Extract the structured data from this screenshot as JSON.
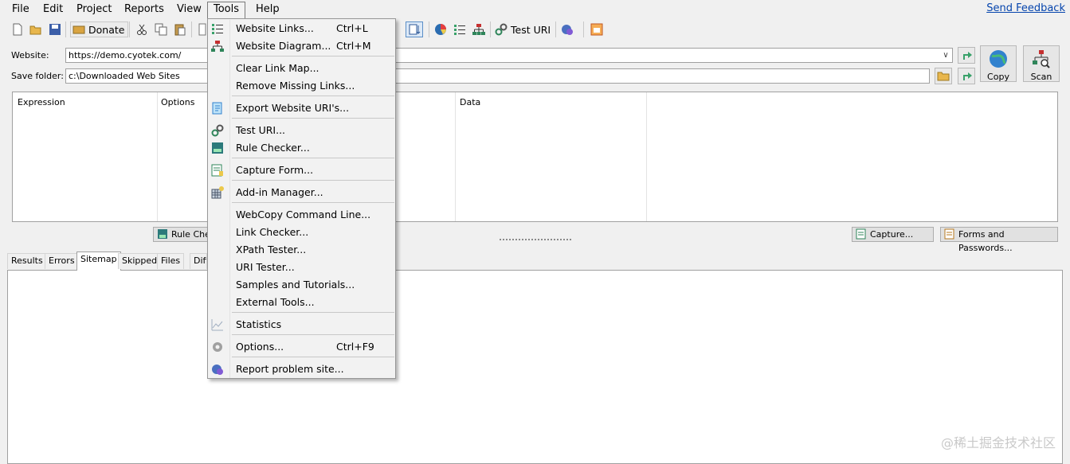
{
  "menubar": {
    "items": [
      "File",
      "Edit",
      "Project",
      "Reports",
      "View",
      "Tools",
      "Help"
    ],
    "feedback": "Send Feedback"
  },
  "toolbar": {
    "donate_label": "Donate",
    "test_uri_label": "Test URI"
  },
  "form": {
    "website_label": "Website:",
    "website_value": "https://demo.cyotek.com/",
    "save_folder_label": "Save folder:",
    "save_folder_value": "c:\\Downloaded Web Sites",
    "copy_label": "Copy",
    "scan_label": "Scan"
  },
  "rules_grid": {
    "columns": [
      "Expression",
      "Options",
      "Data"
    ]
  },
  "buttons": {
    "rule_checker": "Rule Chec",
    "capture": "Capture...",
    "forms_passwords": "Forms and Passwords..."
  },
  "tabs": [
    "Results",
    "Errors",
    "Sitemap",
    "Skipped",
    "Files",
    "Diff"
  ],
  "active_tab": "Sitemap",
  "tools_menu": {
    "items": [
      {
        "label": "Website Links...",
        "shortcut": "Ctrl+L",
        "icon": "list-icon"
      },
      {
        "label": "Website Diagram...",
        "shortcut": "Ctrl+M",
        "icon": "sitemap-icon"
      },
      {
        "label": "Clear Link Map...",
        "shortcut": "",
        "icon": ""
      },
      {
        "label": "Remove Missing Links...",
        "shortcut": "",
        "icon": ""
      },
      {
        "label": "Export Website URI's...",
        "shortcut": "",
        "icon": "export-icon"
      },
      {
        "label": "Test URI...",
        "shortcut": "",
        "icon": "link-icon"
      },
      {
        "label": "Rule Checker...",
        "shortcut": "",
        "icon": "rule-icon"
      },
      {
        "label": "Capture Form...",
        "shortcut": "",
        "icon": "form-icon"
      },
      {
        "label": "Add-in Manager...",
        "shortcut": "",
        "icon": "addin-icon"
      },
      {
        "label": "WebCopy Command Line...",
        "shortcut": "",
        "icon": ""
      },
      {
        "label": "Link Checker...",
        "shortcut": "",
        "icon": ""
      },
      {
        "label": "XPath Tester...",
        "shortcut": "",
        "icon": ""
      },
      {
        "label": "URI Tester...",
        "shortcut": "",
        "icon": ""
      },
      {
        "label": "Samples and Tutorials...",
        "shortcut": "",
        "icon": ""
      },
      {
        "label": "External Tools...",
        "shortcut": "",
        "icon": ""
      },
      {
        "label": "Statistics",
        "shortcut": "",
        "icon": "chart-icon"
      },
      {
        "label": "Options...",
        "shortcut": "Ctrl+F9",
        "icon": "gear-icon"
      },
      {
        "label": "Report problem site...",
        "shortcut": "",
        "icon": "bug-icon"
      }
    ]
  },
  "watermark": "@稀土掘金技术社区",
  "colors": {
    "accent": "#1e73be",
    "link": "#0645ad"
  }
}
